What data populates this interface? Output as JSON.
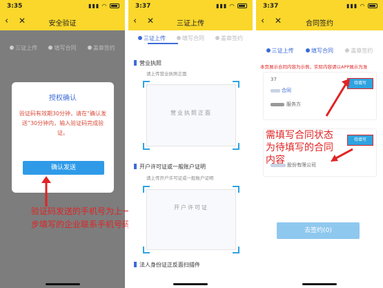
{
  "screen1": {
    "time": "3:35",
    "title": "安全验证",
    "steps": [
      "三证上传",
      "填写合同",
      "盖章签约"
    ],
    "modal_title": "授权确认",
    "modal_text": "验证码有效期30分钟，请在“确认发送”30分钟内，输入验证码完成验证。",
    "confirm_label": "确认发送",
    "annotation": "验证码发送的手机号为上一步填写的企业联系手机号码"
  },
  "screen2": {
    "time": "3:37",
    "title": "三证上传",
    "steps": [
      "三证上传",
      "填写合同",
      "盖章签约"
    ],
    "sec1_title": "营业执照",
    "sec1_sub": "请上传营业执照正面",
    "card1_label": "营业执照正面",
    "sec2_title": "开户许可证或一般账户证明",
    "sec2_sub": "请上传开户许可证或一般账户证明",
    "card2_label": "开户许可证",
    "sec3_title": "法人身份证正反面扫描件"
  },
  "screen3": {
    "time": "3:37",
    "title": "合同签约",
    "steps": [
      "三证上传",
      "填写合同",
      "盖章签约"
    ],
    "note": "本页展示合同内容为示例，实际内容请以APP展示为准",
    "card1_fill": "待填写",
    "card1_line1": "37",
    "card1_line2": "合同",
    "card1_line3": "服务方",
    "card2_fill": "待填写",
    "card2_line": "股份有限公司",
    "annotation": "需填写合同状态为待填写的合同内容",
    "sign_label": "去签约(0)"
  },
  "colors": {
    "yellow": "#fad72a",
    "blue": "#3c6bd8",
    "red": "#e02424",
    "button": "#2f9be8"
  }
}
